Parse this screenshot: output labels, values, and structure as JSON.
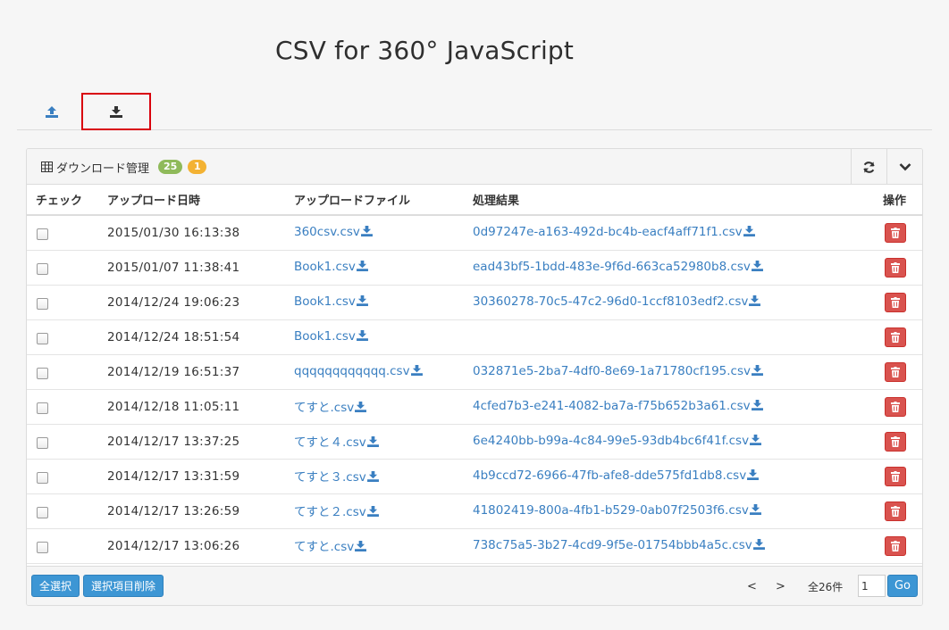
{
  "header": {
    "title": "CSV for 360° JavaScript"
  },
  "tabs": [
    {
      "icon": "upload-icon",
      "active": false
    },
    {
      "icon": "download-icon",
      "active": true
    }
  ],
  "panel": {
    "title": "ダウンロード管理",
    "badge_count": "25",
    "badge_alert": "1",
    "columns": {
      "check": "チェック",
      "date": "アップロード日時",
      "file": "アップロードファイル",
      "result": "処理結果",
      "action": "操作"
    },
    "rows": [
      {
        "date": "2015/01/30 16:13:38",
        "file": "360csv.csv",
        "result": "0d97247e-a163-492d-bc4b-eacf4aff71f1.csv"
      },
      {
        "date": "2015/01/07 11:38:41",
        "file": "Book1.csv",
        "result": "ead43bf5-1bdd-483e-9f6d-663ca52980b8.csv"
      },
      {
        "date": "2014/12/24 19:06:23",
        "file": "Book1.csv",
        "result": "30360278-70c5-47c2-96d0-1ccf8103edf2.csv"
      },
      {
        "date": "2014/12/24 18:51:54",
        "file": "Book1.csv",
        "result": ""
      },
      {
        "date": "2014/12/19 16:51:37",
        "file": "qqqqqqqqqqqq.csv",
        "result": "032871e5-2ba7-4df0-8e69-1a71780cf195.csv"
      },
      {
        "date": "2014/12/18 11:05:11",
        "file": "てすと.csv",
        "result": "4cfed7b3-e241-4082-ba7a-f75b652b3a61.csv"
      },
      {
        "date": "2014/12/17 13:37:25",
        "file": "てすと４.csv",
        "result": "6e4240bb-b99a-4c84-99e5-93db4bc6f41f.csv"
      },
      {
        "date": "2014/12/17 13:31:59",
        "file": "てすと３.csv",
        "result": "4b9ccd72-6966-47fb-afe8-dde575fd1db8.csv"
      },
      {
        "date": "2014/12/17 13:26:59",
        "file": "てすと２.csv",
        "result": "41802419-800a-4fb1-b529-0ab07f2503f6.csv"
      },
      {
        "date": "2014/12/17 13:06:26",
        "file": "てすと.csv",
        "result": "738c75a5-3b27-4cd9-9f5e-01754bbb4a5c.csv"
      }
    ]
  },
  "footer": {
    "select_all": "全選択",
    "delete_selected": "選択項目削除",
    "prev": "<",
    "next": ">",
    "total": "全26件",
    "page_value": "1",
    "go": "Go"
  },
  "colors": {
    "link": "#3a7fc1",
    "primary_button": "#3d96d4",
    "danger_button": "#d9534f",
    "badge_green": "#8fba5a",
    "badge_yellow": "#f3b233",
    "highlight_border": "#d9000d"
  }
}
